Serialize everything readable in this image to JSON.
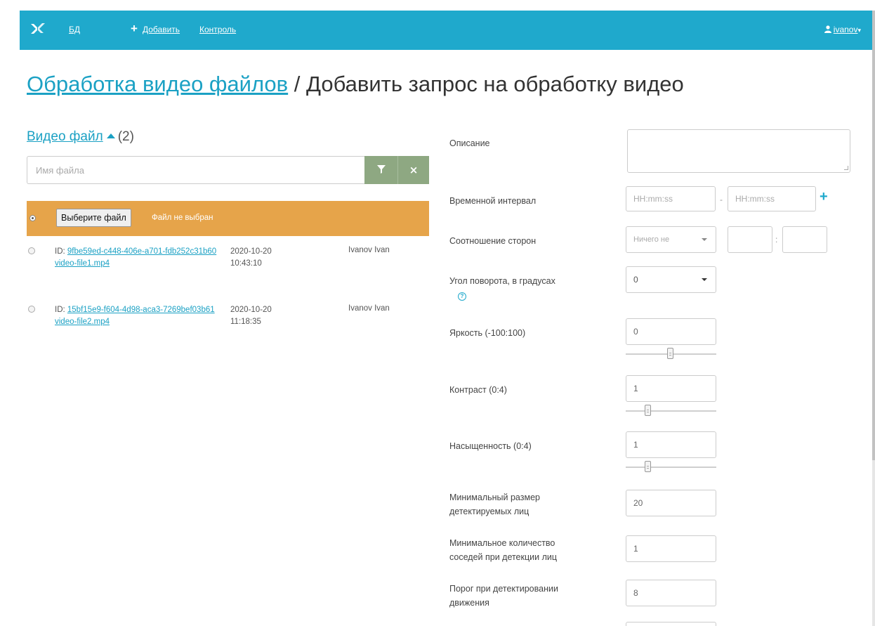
{
  "navbar": {
    "links": [
      "БД",
      "Добавить",
      "Контроль"
    ],
    "user": "ivanov"
  },
  "title": {
    "link": "Обработка видео файлов",
    "separator": " / ",
    "current": "Добавить запрос на обработку видео"
  },
  "video_section": {
    "title": "Видео файл",
    "count": "(2)",
    "search_placeholder": "Имя файла",
    "clear_label": "×",
    "choose_file_label": "Выберите файл",
    "no_file_label": "Файл не выбран",
    "files": [
      {
        "id_prefix": "ID: ",
        "id": "9fbe59ed-c448-406e-a701-fdb252c31b60",
        "filename": "video-file1.mp4",
        "date": "2020-10-20",
        "time": "10:43:10",
        "user": "Ivanov Ivan"
      },
      {
        "id_prefix": "ID: ",
        "id": "15bf15e9-f604-4d98-aca3-7269bef03b61",
        "filename": "video-file2.mp4",
        "date": "2020-10-20",
        "time": "11:18:35",
        "user": "Ivanov Ivan"
      }
    ]
  },
  "form": {
    "description_label": "Описание",
    "time_interval_label": "Временной интервал",
    "time_placeholder": "HH:mm:ss",
    "time_separator": "-",
    "aspect_ratio_label": "Соотношение сторон",
    "aspect_ratio_select": "Ничего не",
    "aspect_separator": ":",
    "rotation_label": "Угол поворота, в градусах",
    "rotation_value": "0",
    "help_glyph": "?",
    "brightness_label": "Яркость (-100:100)",
    "brightness_value": "0",
    "brightness_level": 0.5,
    "contrast_label": "Контраст (0:4)",
    "contrast_value": "1",
    "contrast_level": 0.25,
    "saturation_label": "Насыщенность (0:4)",
    "saturation_value": "1",
    "saturation_level": 0.25,
    "min_face_size_label_1": "Минимальный размер",
    "min_face_size_label_2": "детектируемых лиц",
    "min_face_size_value": "20",
    "min_neighbors_label_1": "Минимальное количество",
    "min_neighbors_label_2": "соседей при детекции лиц",
    "min_neighbors_value": "1",
    "motion_threshold_label_1": "Порог при детектировании",
    "motion_threshold_label_2": "движения",
    "motion_threshold_value": "8"
  },
  "colors": {
    "navbar": "#1fa9cc",
    "link": "#1ba1c4",
    "upload_row": "#e6a44a",
    "filter_button": "#8ea882"
  }
}
